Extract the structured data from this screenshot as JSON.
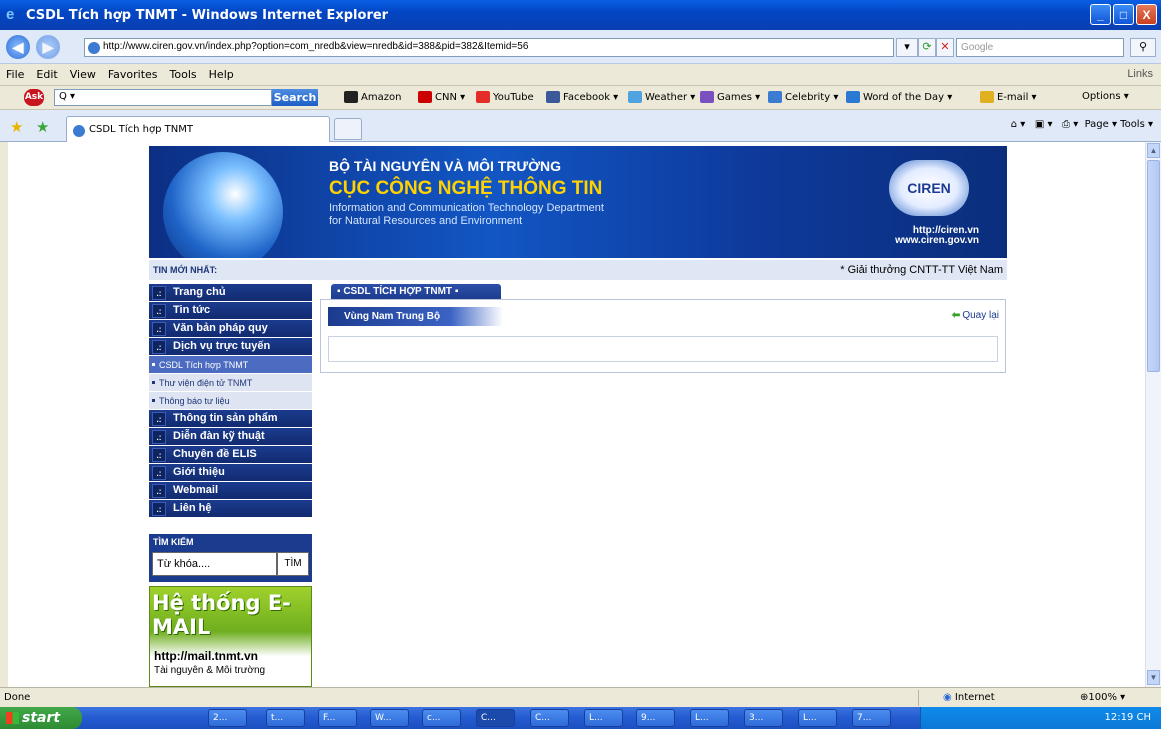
{
  "window": {
    "title": "CSDL Tích hợp TNMT - Windows Internet Explorer",
    "controls": [
      "_",
      "□",
      "X"
    ]
  },
  "address": {
    "url": "http://www.ciren.gov.vn/index.php?option=com_nredb&view=nredb&id=388&pid=382&Itemid=56",
    "search_placeholder": "Google"
  },
  "menu": {
    "items": [
      "File",
      "Edit",
      "View",
      "Favorites",
      "Tools",
      "Help"
    ],
    "links": "Links"
  },
  "ask_toolbar": {
    "logo": "Ask",
    "input": "Q ▾",
    "search_label": "Search",
    "bookmarks": [
      {
        "label": "Amazon",
        "color": "#222222"
      },
      {
        "label": "CNN ▾",
        "color": "#cc0000"
      },
      {
        "label": "YouTube",
        "color": "#e52d27"
      },
      {
        "label": "Facebook ▾",
        "color": "#3b5998"
      },
      {
        "label": "Weather ▾",
        "color": "#4fa3e0"
      },
      {
        "label": "Games ▾",
        "color": "#7a4fc0"
      },
      {
        "label": "Celebrity ▾",
        "color": "#3b7bd1"
      },
      {
        "label": "Word of the Day ▾",
        "color": "#2b79d3"
      },
      {
        "label": "E-mail ▾",
        "color": "#e0b020"
      }
    ],
    "options": "Options ▾"
  },
  "tabs": {
    "active": "CSDL Tích hợp TNMT",
    "commands": "Page ▾   Tools ▾"
  },
  "banner": {
    "ministry": "BỘ TÀI NGUYÊN VÀ MÔI TRƯỜNG",
    "department": "CỤC CÔNG NGHỆ THÔNG TIN",
    "english_1": "Information and Communication Technology Department",
    "english_2": "for Natural Resources and Environment",
    "logo_text": "CIREN",
    "url_1": "http://ciren.vn",
    "url_2": "www.ciren.gov.vn"
  },
  "news": {
    "label": "TIN MỚI NHẤT:",
    "ticker": "* Giải thưởng CNTT-TT Việt Nam"
  },
  "sidebar": {
    "items": [
      {
        "label": "Trang chủ"
      },
      {
        "label": "Tin tức"
      },
      {
        "label": "Văn bản pháp quy"
      },
      {
        "label": "Dịch vụ trực tuyến"
      }
    ],
    "subitems": [
      {
        "label": "CSDL Tích hợp TNMT"
      },
      {
        "label": "Thư viện điện tử TNMT"
      },
      {
        "label": "Thông báo tư liệu"
      }
    ],
    "items2": [
      {
        "label": "Thông tin sản phẩm"
      },
      {
        "label": "Diễn đàn kỹ thuật"
      },
      {
        "label": "Chuyên đề ELIS"
      },
      {
        "label": "Giới thiệu"
      },
      {
        "label": "Webmail"
      },
      {
        "label": "Liên hệ"
      }
    ],
    "search_heading": "TÌM KIẾM",
    "search_placeholder": "Từ khóa....",
    "search_button": "TÌM"
  },
  "mail_ad": {
    "heading": "Hệ thống E-MAIL",
    "url": "http://mail.tnmt.vn",
    "desc": "Tài nguyên & Môi trường"
  },
  "content": {
    "tab": "CSDL TÍCH HỢP TNMT",
    "region": "Vùng Nam Trung Bộ",
    "back": "Quay lại"
  },
  "status": {
    "text": "Done",
    "zone": "Internet",
    "zoom": "100%"
  },
  "taskbar": {
    "start": "start",
    "buttons": [
      "2...",
      "t...",
      "F...",
      "W...",
      "c...",
      "C...",
      "C...",
      "L...",
      "9...",
      "L...",
      "3...",
      "L...",
      "7..."
    ],
    "clock": "12:19 CH"
  }
}
